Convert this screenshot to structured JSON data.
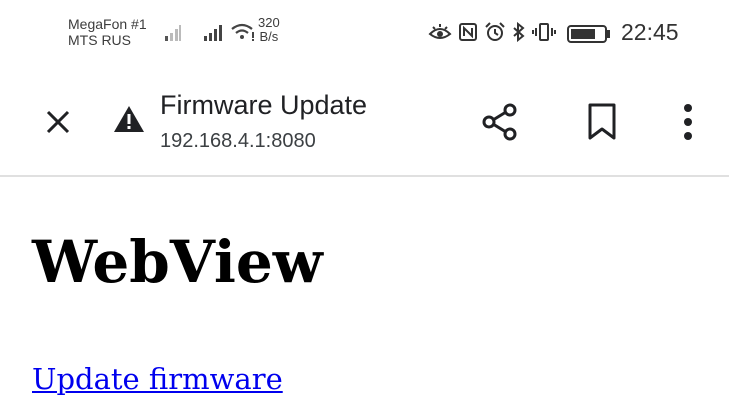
{
  "status_bar": {
    "carrier_1": "MegaFon #1",
    "carrier_2": "MTS RUS",
    "speed_value": "320",
    "speed_unit": "B/s",
    "time": "22:45",
    "icons": [
      "eye-icon",
      "nfc-icon",
      "alarm-icon",
      "bluetooth-icon",
      "vibrate-icon",
      "battery-icon"
    ]
  },
  "toolbar": {
    "title": "Firmware Update",
    "url": "192.168.4.1:8080",
    "icons": [
      "close-icon",
      "warning-icon",
      "share-icon",
      "bookmark-icon",
      "more-vert-icon"
    ]
  },
  "page": {
    "heading": "WebView",
    "link": "Update firmware",
    "link_color": "#0000ee"
  }
}
